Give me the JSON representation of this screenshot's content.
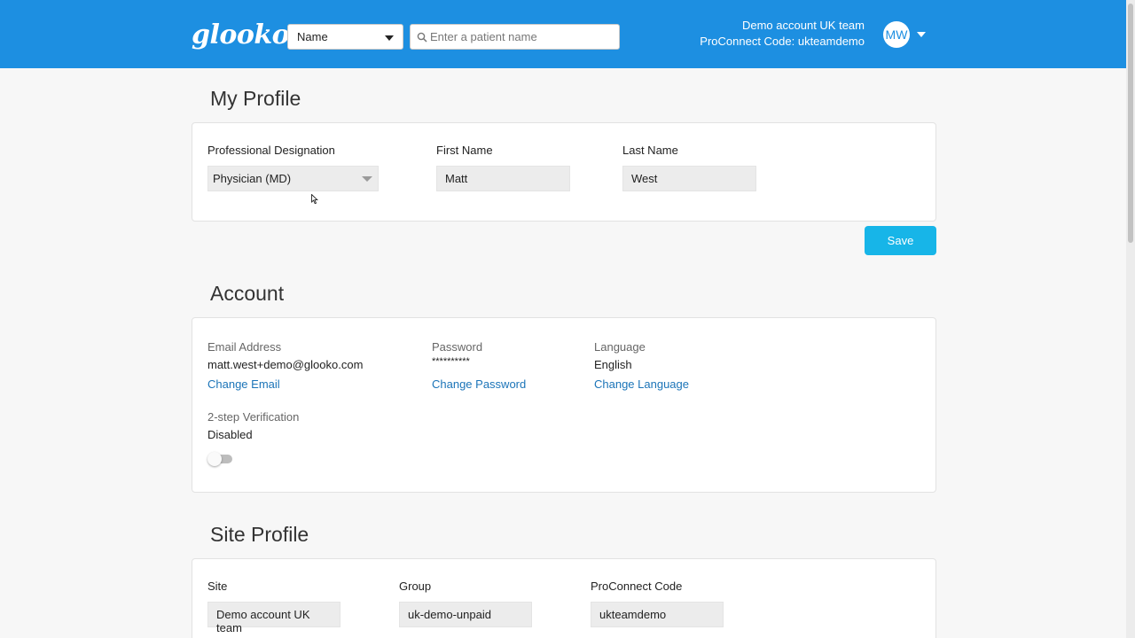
{
  "header": {
    "logo_text": "glooko",
    "search_type": "Name",
    "search_placeholder": "Enter a patient name",
    "account_name": "Demo account UK team",
    "proconnect_line": "ProConnect Code: ukteamdemo",
    "avatar_initials": "MW",
    "icons": [
      "search-icon",
      "chevron-down-icon"
    ],
    "colors": {
      "header_bg": "#1d8fe1",
      "accent_button": "#17b5e8",
      "link": "#1b74b8"
    }
  },
  "my_profile": {
    "title": "My Profile",
    "designation_label": "Professional Designation",
    "designation_value": "Physician (MD)",
    "first_name_label": "First Name",
    "first_name_value": "Matt",
    "last_name_label": "Last Name",
    "last_name_value": "West",
    "save_label": "Save"
  },
  "account": {
    "title": "Account",
    "email_label": "Email Address",
    "email_value": "matt.west+demo@glooko.com",
    "change_email": "Change Email",
    "password_label": "Password",
    "password_value": "**********",
    "change_password": "Change Password",
    "language_label": "Language",
    "language_value": "English",
    "change_language": "Change Language",
    "two_step_label": "2-step Verification",
    "two_step_value": "Disabled",
    "two_step_enabled": false
  },
  "site_profile": {
    "title": "Site Profile",
    "site_label": "Site",
    "site_value": "Demo account UK team",
    "group_label": "Group",
    "group_value": "uk-demo-unpaid",
    "proconnect_label": "ProConnect Code",
    "proconnect_value": "ukteamdemo"
  }
}
